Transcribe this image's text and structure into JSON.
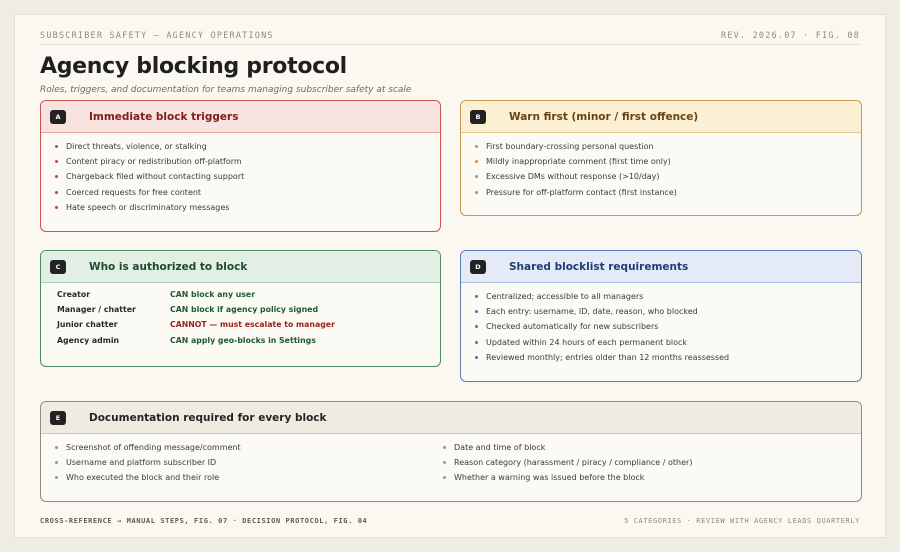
{
  "header": {
    "left": "SUBSCRIBER SAFETY — AGENCY OPERATIONS",
    "right": "REV. 2026.07 · FIG. 08"
  },
  "title": "Agency blocking protocol",
  "subtitle": "Roles, triggers, and documentation for teams managing subscriber safety at scale",
  "cards": {
    "a": {
      "badge": "A",
      "title": "Immediate block triggers",
      "items": [
        "Direct threats, violence, or stalking",
        "Content piracy or redistribution off-platform",
        "Chargeback filed without contacting support",
        "Coerced requests for free content",
        "Hate speech or discriminatory messages"
      ]
    },
    "b": {
      "badge": "B",
      "title": "Warn first (minor / first offence)",
      "items": [
        "First boundary-crossing personal question",
        "Mildly inappropriate comment (first time only)",
        "Excessive DMs without response (>10/day)",
        "Pressure for off-platform contact (first instance)"
      ]
    },
    "c": {
      "badge": "C",
      "title": "Who is authorized to block",
      "rows": [
        {
          "role": "Creator",
          "perm": "CAN block any user"
        },
        {
          "role": "Manager / chatter",
          "perm": "CAN block if agency policy signed"
        },
        {
          "role": "Junior chatter",
          "perm": "CANNOT — must escalate to manager"
        },
        {
          "role": "Agency admin",
          "perm": "CAN apply geo-blocks in Settings"
        }
      ]
    },
    "d": {
      "badge": "D",
      "title": "Shared blocklist requirements",
      "items": [
        "Centralized; accessible to all managers",
        "Each entry: username, ID, date, reason, who blocked",
        "Checked automatically for new subscribers",
        "Updated within 24 hours of each permanent block",
        "Reviewed monthly; entries older than 12 months reassessed"
      ]
    },
    "e": {
      "badge": "E",
      "title": "Documentation required for every block",
      "left_items": [
        "Screenshot of offending message/comment",
        "Username and platform subscriber ID",
        "Who executed the block and their role"
      ],
      "right_items": [
        "Date and time of block",
        "Reason category (harassment / piracy / compliance / other)",
        "Whether a warning was issued before the block"
      ]
    }
  },
  "footer": {
    "left": "CROSS-REFERENCE → MANUAL STEPS, FIG. 07 · DECISION PROTOCOL, FIG. 04",
    "right": "5 CATEGORIES · REVIEW WITH AGENCY LEADS QUARTERLY"
  }
}
